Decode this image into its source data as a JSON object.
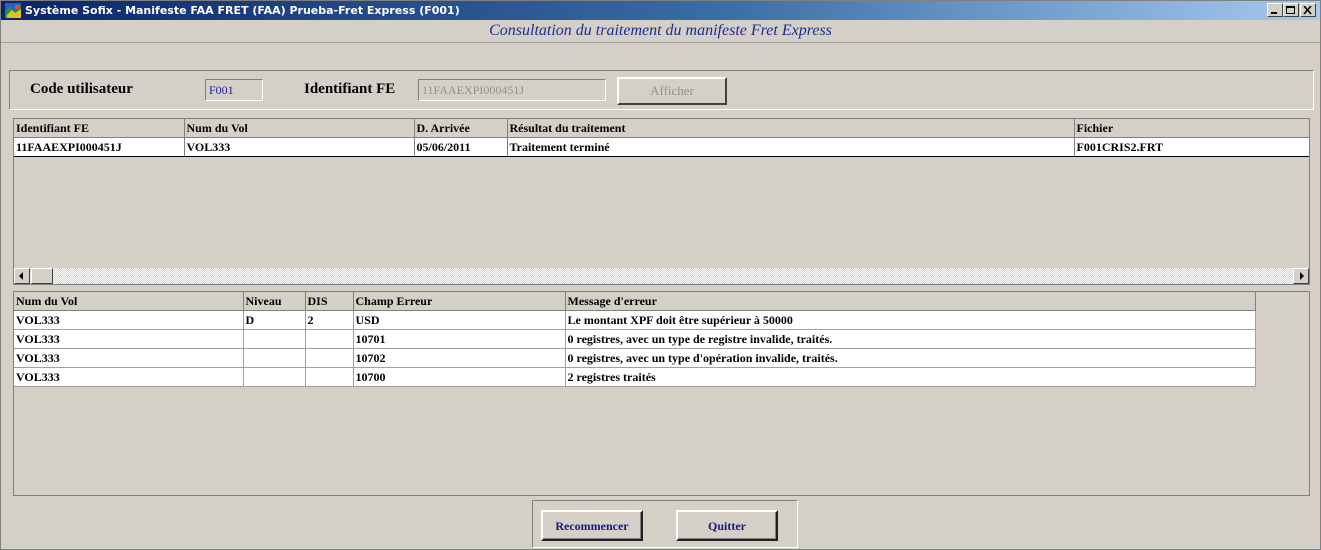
{
  "window": {
    "title": "Système Sofix - Manifeste  FAA FRET (FAA) Prueba-Fret Express (F001)",
    "subtitle": "Consultation du traitement du manifeste Fret Express",
    "controls": [
      "minimize-icon",
      "maximize-icon",
      "close-icon"
    ]
  },
  "filters": {
    "user_code_label": "Code utilisateur",
    "user_code_value": "F001",
    "fe_id_label": "Identifiant FE",
    "fe_id_value": "11FAAEXPI000451J",
    "show_button": "Afficher"
  },
  "processing_table": {
    "columns": [
      "Identifiant FE",
      "Num du Vol",
      "D. Arrivée",
      "Résultat du traitement",
      "Fichier"
    ],
    "rows": [
      [
        "11FAAEXPI000451J",
        "VOL333",
        "05/06/2011",
        "Traitement terminé",
        "F001CRIS2.FRT"
      ]
    ]
  },
  "errors_table": {
    "columns": [
      "Num du Vol",
      "Niveau",
      "DIS",
      "Champ Erreur",
      "Message d'erreur"
    ],
    "rows": [
      [
        "VOL333",
        "D",
        "2",
        "USD",
        "Le montant XPF doit être supérieur à 50000"
      ],
      [
        "VOL333",
        "",
        "",
        "10701",
        "0 registres, avec un type de registre invalide, traités."
      ],
      [
        "VOL333",
        "",
        "",
        "10702",
        "0 registres, avec un type d'opération invalide, traités."
      ],
      [
        "VOL333",
        "",
        "",
        "10700",
        "2 registres traités"
      ]
    ]
  },
  "actions": {
    "restart": "Recommencer",
    "quit": "Quitter"
  },
  "colors": {
    "titlebar_start": "#0a246a",
    "titlebar_end": "#a6caf0",
    "subtitle_text": "#1f2c8f",
    "window_bg": "#d4d0c8"
  }
}
